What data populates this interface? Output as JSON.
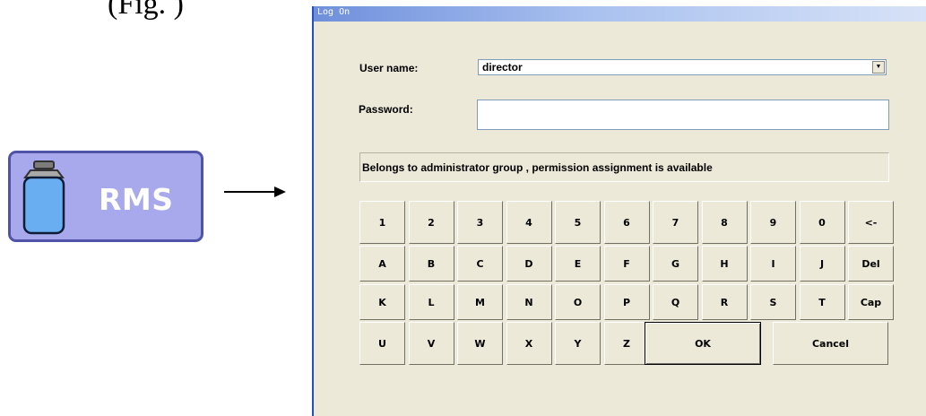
{
  "caption": "(Fig. )",
  "rms_button": {
    "label": "RMS"
  },
  "dialog": {
    "title": "Log On",
    "username_label": "User name:",
    "username_value": "director",
    "password_label": "Password:",
    "password_value": "",
    "info_text": "Belongs to administrator group , permission assignment is available",
    "keyboard_rows": [
      [
        "1",
        "2",
        "3",
        "4",
        "5",
        "6",
        "7",
        "8",
        "9",
        "0",
        "<-"
      ],
      [
        "A",
        "B",
        "C",
        "D",
        "E",
        "F",
        "G",
        "H",
        "I",
        "J",
        "Del"
      ],
      [
        "K",
        "L",
        "M",
        "N",
        "O",
        "P",
        "Q",
        "R",
        "S",
        "T",
        "Cap"
      ],
      [
        "U",
        "V",
        "W",
        "X",
        "Y",
        "Z"
      ]
    ],
    "ok_label": "OK",
    "cancel_label": "Cancel"
  }
}
